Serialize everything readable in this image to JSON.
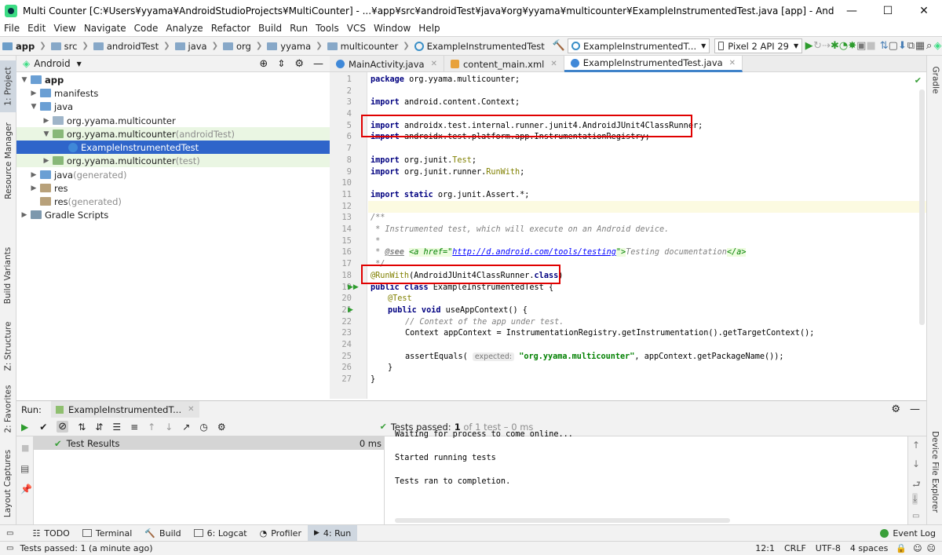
{
  "window": {
    "title": "Multi Counter [C:¥Users¥yyama¥AndroidStudioProjects¥MultiCounter] - ...¥app¥src¥androidTest¥java¥org¥yyama¥multicounter¥ExampleInstrumentedTest.java [app] - Android Studio",
    "minimize": "—",
    "maximize": "☐",
    "close": "✕"
  },
  "menu": [
    "File",
    "Edit",
    "View",
    "Navigate",
    "Code",
    "Analyze",
    "Refactor",
    "Build",
    "Run",
    "Tools",
    "VCS",
    "Window",
    "Help"
  ],
  "breadcrumbs": [
    "app",
    "src",
    "androidTest",
    "java",
    "org",
    "yyama",
    "multicounter",
    "ExampleInstrumentedTest"
  ],
  "toolbar": {
    "run_config": "ExampleInstrumentedT...",
    "device": "Pixel 2 API 29"
  },
  "left_strip": {
    "project": "1: Project",
    "resource_manager": "Resource Manager",
    "build_variants": "Build Variants",
    "structure": "Z: Structure",
    "favorites": "2: Favorites",
    "layout_captures": "Layout Captures"
  },
  "right_strip": {
    "gradle": "Gradle",
    "device_file_explorer": "Device File Explorer"
  },
  "project_panel": {
    "view_mode": "Android",
    "tree": [
      {
        "label": "app",
        "suffix": ""
      },
      {
        "label": "manifests",
        "suffix": ""
      },
      {
        "label": "java",
        "suffix": ""
      },
      {
        "label": "org.yyama.multicounter",
        "suffix": ""
      },
      {
        "label": "org.yyama.multicounter",
        "suffix": " (androidTest)"
      },
      {
        "label": "ExampleInstrumentedTest",
        "suffix": ""
      },
      {
        "label": "org.yyama.multicounter",
        "suffix": " (test)"
      },
      {
        "label": "java",
        "suffix": " (generated)"
      },
      {
        "label": "res",
        "suffix": ""
      },
      {
        "label": "res",
        "suffix": " (generated)"
      },
      {
        "label": "Gradle Scripts",
        "suffix": ""
      }
    ]
  },
  "editor_tabs": [
    "MainActivity.java",
    "content_main.xml",
    "ExampleInstrumentedTest.java"
  ],
  "code": {
    "line_numbers": [
      "1",
      "2",
      "3",
      "4",
      "5",
      "6",
      "7",
      "8",
      "9",
      "10",
      "11",
      "12",
      "13",
      "14",
      "15",
      "16",
      "17",
      "18",
      "19",
      "20",
      "21",
      "22",
      "23",
      "24",
      "25",
      "26",
      "27"
    ],
    "l1_kw": "package",
    "l1_rest": " org.yyama.multicounter;",
    "l3_kw": "import",
    "l3_rest": " android.content.Context;",
    "l5_kw": "import",
    "l5_rest": " androidx.test.internal.runner.junit4.AndroidJUnit4ClassRunner;",
    "l6_kw": "import",
    "l6_rest": " androidx.test.platform.app.InstrumentationRegistry;",
    "l8_kw": "import",
    "l8_rest": " org.junit.",
    "l8_ann": "Test",
    "l8_end": ";",
    "l9_kw": "import",
    "l9_rest": " org.junit.runner.",
    "l9_ann": "RunWith",
    "l9_end": ";",
    "l11_kw": "import static",
    "l11_rest": " org.junit.Assert.*;",
    "l13": "/**",
    "l14": " * Instrumented test, which will execute on an Android device.",
    "l15": " *",
    "l16_a": " * ",
    "l16_see": "@see",
    "l16_tag1": "<a href=\"",
    "l16_link": "http://d.android.com/tools/testing",
    "l16_tag2": "\">",
    "l16_text": "Testing documentation",
    "l16_tag3": "</a>",
    "l17": " */",
    "l18_ann": "@RunWith",
    "l18_mid": "(AndroidJUnit4ClassRunner.",
    "l18_kw": "class",
    "l18_end": ")",
    "l19_kw": "public class",
    "l19_rest": " ExampleInstrumentedTest {",
    "l20_ann": "@Test",
    "l21_kw": "public void",
    "l21_rest": " useAppContext() {",
    "l22": "// Context of the app under test.",
    "l23": "Context appContext = InstrumentationRegistry.getInstrumentation().getTargetContext();",
    "l25_a": "assertEquals( ",
    "l25_hint": "expected:",
    "l25_str": " \"org.yyama.multicounter\"",
    "l25_end": ", appContext.getPackageName());",
    "l26": "}",
    "l27": "}"
  },
  "run_panel": {
    "label": "Run:",
    "config_tab": "ExampleInstrumentedT...",
    "status_prefix": "Tests passed:",
    "status_count": " 1",
    "status_suffix": " of 1 test – 0 ms",
    "tree_item": "Test Results",
    "tree_time": "0 ms",
    "output": [
      "Waiting for process to come online...",
      "Started running tests",
      "Tests ran to completion."
    ]
  },
  "bottom_tabs": [
    "TODO",
    "Terminal",
    "Build",
    "6: Logcat",
    "Profiler",
    "4: Run"
  ],
  "event_log": "Event Log",
  "status": {
    "message": "Tests passed: 1 (a minute ago)",
    "position": "12:1",
    "line_sep": "CRLF",
    "encoding": "UTF-8",
    "indent": "4 spaces"
  }
}
